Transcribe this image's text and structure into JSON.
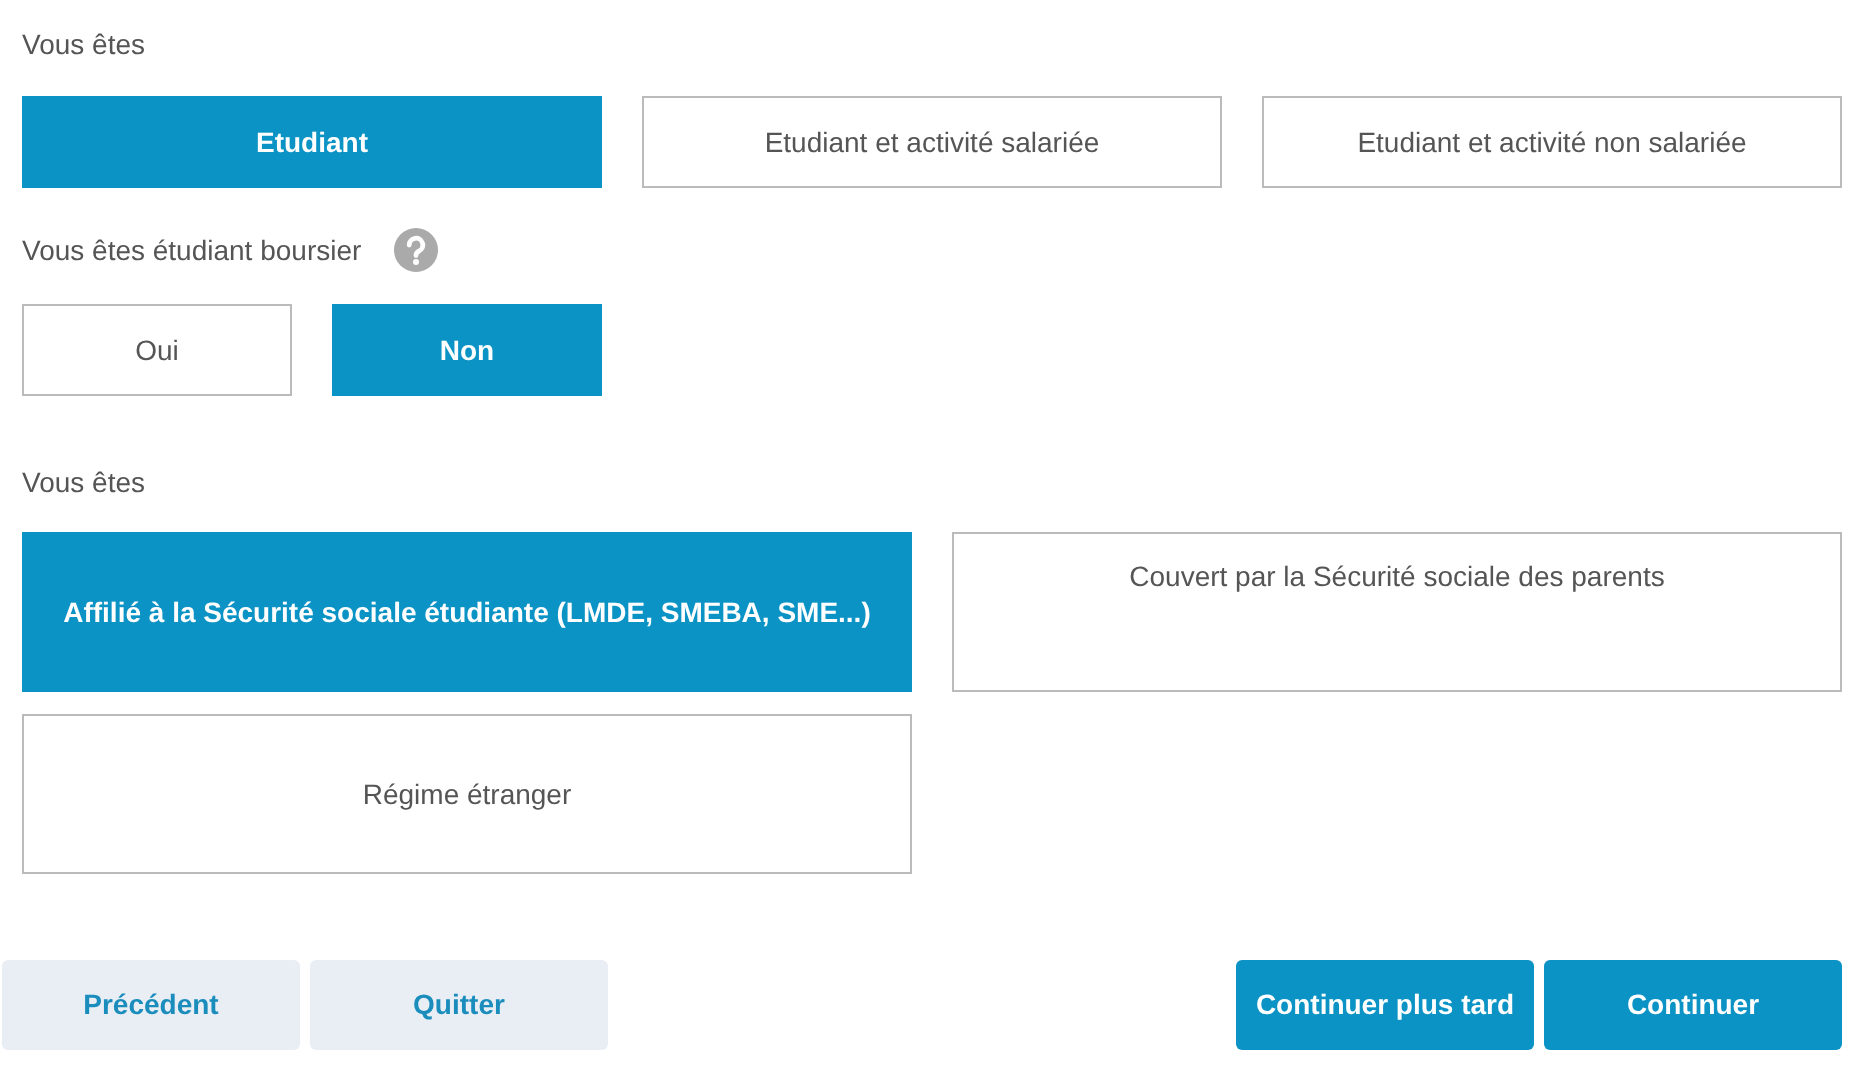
{
  "sections": [
    {
      "label": "Vous êtes",
      "help": false,
      "kind": "wide",
      "options": [
        {
          "label": "Etudiant",
          "selected": true
        },
        {
          "label": "Etudiant et activité salariée",
          "selected": false
        },
        {
          "label": "Etudiant et activité non salariée",
          "selected": false
        }
      ]
    },
    {
      "label": "Vous êtes étudiant boursier",
      "help": true,
      "kind": "narrow",
      "options": [
        {
          "label": "Oui",
          "selected": false
        },
        {
          "label": "Non",
          "selected": true
        }
      ]
    },
    {
      "label": "Vous êtes",
      "help": false,
      "kind": "tall",
      "options": [
        {
          "label": "Affilié à la Sécurité sociale étudiante (LMDE, SMEBA, SME...)",
          "selected": true
        },
        {
          "label": "Couvert par la Sécurité sociale des parents",
          "selected": false
        },
        {
          "label": "Régime étranger",
          "selected": false
        }
      ]
    }
  ],
  "footer": [
    {
      "label": "Précédent",
      "kind": "secondary"
    },
    {
      "label": "Quitter",
      "kind": "secondary"
    },
    {
      "label": "Continuer plus tard",
      "kind": "primary"
    },
    {
      "label": "Continuer",
      "kind": "primary"
    }
  ]
}
